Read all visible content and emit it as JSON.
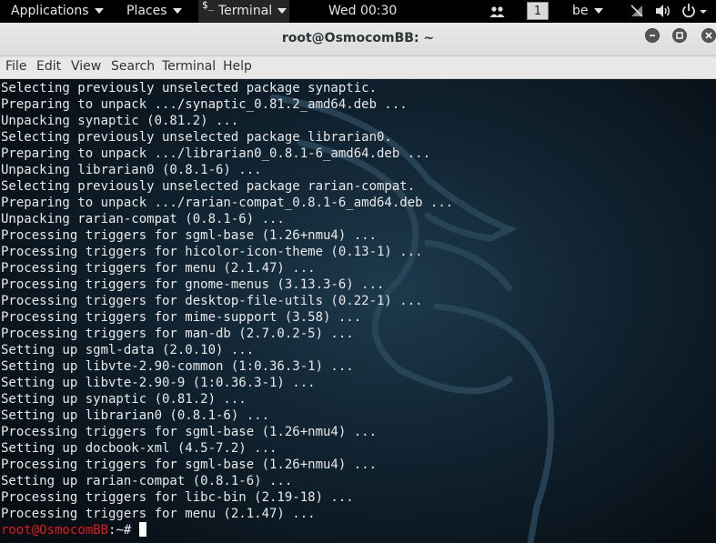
{
  "topbar": {
    "applications": "Applications",
    "places": "Places",
    "terminal_icon": "$_",
    "terminal": "Terminal",
    "clock": "Wed 00:30",
    "workspace": "1",
    "keyboard_layout": "be"
  },
  "window": {
    "title": "root@OsmocomBB: ~"
  },
  "menubar": {
    "file": "File",
    "edit": "Edit",
    "view": "View",
    "search": "Search",
    "terminal": "Terminal",
    "help": "Help"
  },
  "terminal": {
    "lines": [
      "Selecting previously unselected package synaptic.",
      "Preparing to unpack .../synaptic_0.81.2_amd64.deb ...",
      "Unpacking synaptic (0.81.2) ...",
      "Selecting previously unselected package librarian0.",
      "Preparing to unpack .../librarian0_0.8.1-6_amd64.deb ...",
      "Unpacking librarian0 (0.8.1-6) ...",
      "Selecting previously unselected package rarian-compat.",
      "Preparing to unpack .../rarian-compat_0.8.1-6_amd64.deb ...",
      "Unpacking rarian-compat (0.8.1-6) ...",
      "Processing triggers for sgml-base (1.26+nmu4) ...",
      "Processing triggers for hicolor-icon-theme (0.13-1) ...",
      "Processing triggers for menu (2.1.47) ...",
      "Processing triggers for gnome-menus (3.13.3-6) ...",
      "Processing triggers for desktop-file-utils (0.22-1) ...",
      "Processing triggers for mime-support (3.58) ...",
      "Processing triggers for man-db (2.7.0.2-5) ...",
      "Setting up sgml-data (2.0.10) ...",
      "Setting up libvte-2.90-common (1:0.36.3-1) ...",
      "Setting up libvte-2.90-9 (1:0.36.3-1) ...",
      "Setting up synaptic (0.81.2) ...",
      "Setting up librarian0 (0.8.1-6) ...",
      "Processing triggers for sgml-base (1.26+nmu4) ...",
      "Setting up docbook-xml (4.5-7.2) ...",
      "Processing triggers for sgml-base (1.26+nmu4) ...",
      "Setting up rarian-compat (0.8.1-6) ...",
      "Processing triggers for libc-bin (2.19-18) ...",
      "Processing triggers for menu (2.1.47) ..."
    ],
    "prompt_user": "root@OsmocomBB",
    "prompt_rest": ":~# "
  },
  "colors": {
    "prompt": "#e01b1b",
    "terminal_text": "#e9e9e9",
    "terminal_bg": "#0b1620"
  },
  "icons": [
    "terminal-icon",
    "people-icon",
    "network-icon",
    "volume-icon",
    "power-icon",
    "minimize-icon",
    "maximize-icon",
    "close-icon",
    "dragon-wallpaper"
  ]
}
